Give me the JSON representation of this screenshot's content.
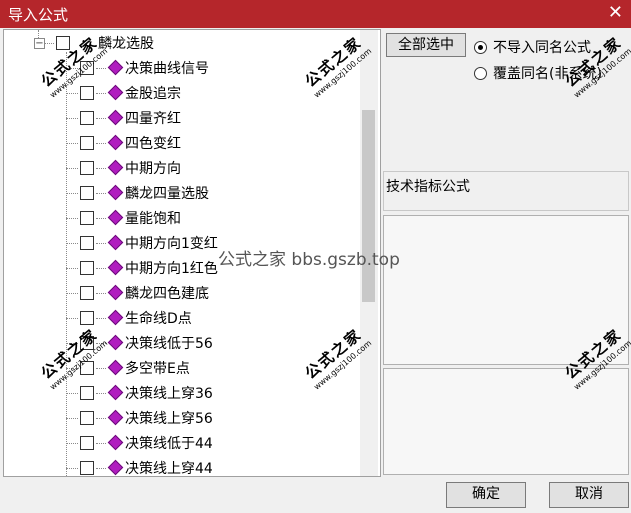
{
  "window": {
    "title": "导入公式"
  },
  "tree": {
    "root": {
      "label": "麟龙选股"
    },
    "items": [
      {
        "label": "决策曲线信号"
      },
      {
        "label": "金股追宗"
      },
      {
        "label": "四量齐红"
      },
      {
        "label": "四色变红"
      },
      {
        "label": "中期方向"
      },
      {
        "label": "麟龙四量选股"
      },
      {
        "label": "量能饱和"
      },
      {
        "label": "中期方向1变红"
      },
      {
        "label": "中期方向1红色"
      },
      {
        "label": "麟龙四色建底"
      },
      {
        "label": "生命线D点"
      },
      {
        "label": "决策线低于56"
      },
      {
        "label": "多空带E点"
      },
      {
        "label": "决策线上穿36"
      },
      {
        "label": "决策线上穿56"
      },
      {
        "label": "决策线低于44"
      },
      {
        "label": "决策线上穿44"
      }
    ]
  },
  "options": {
    "select_all_label": "全部选中",
    "radio_skip_label": "不导入同名公式",
    "radio_overwrite_label": "覆盖同名(非系统)",
    "selected": "skip"
  },
  "info": {
    "category_label": "技术指标公式"
  },
  "buttons": {
    "ok_label": "确定",
    "cancel_label": "取消"
  },
  "watermark": {
    "text": "公式之家 bbs.gszb.top"
  },
  "stamps": {
    "big": "公式之家",
    "small": "www.gszj100.com"
  },
  "colors": {
    "titlebar": "#b5262b",
    "gem": "#b01dbf"
  }
}
